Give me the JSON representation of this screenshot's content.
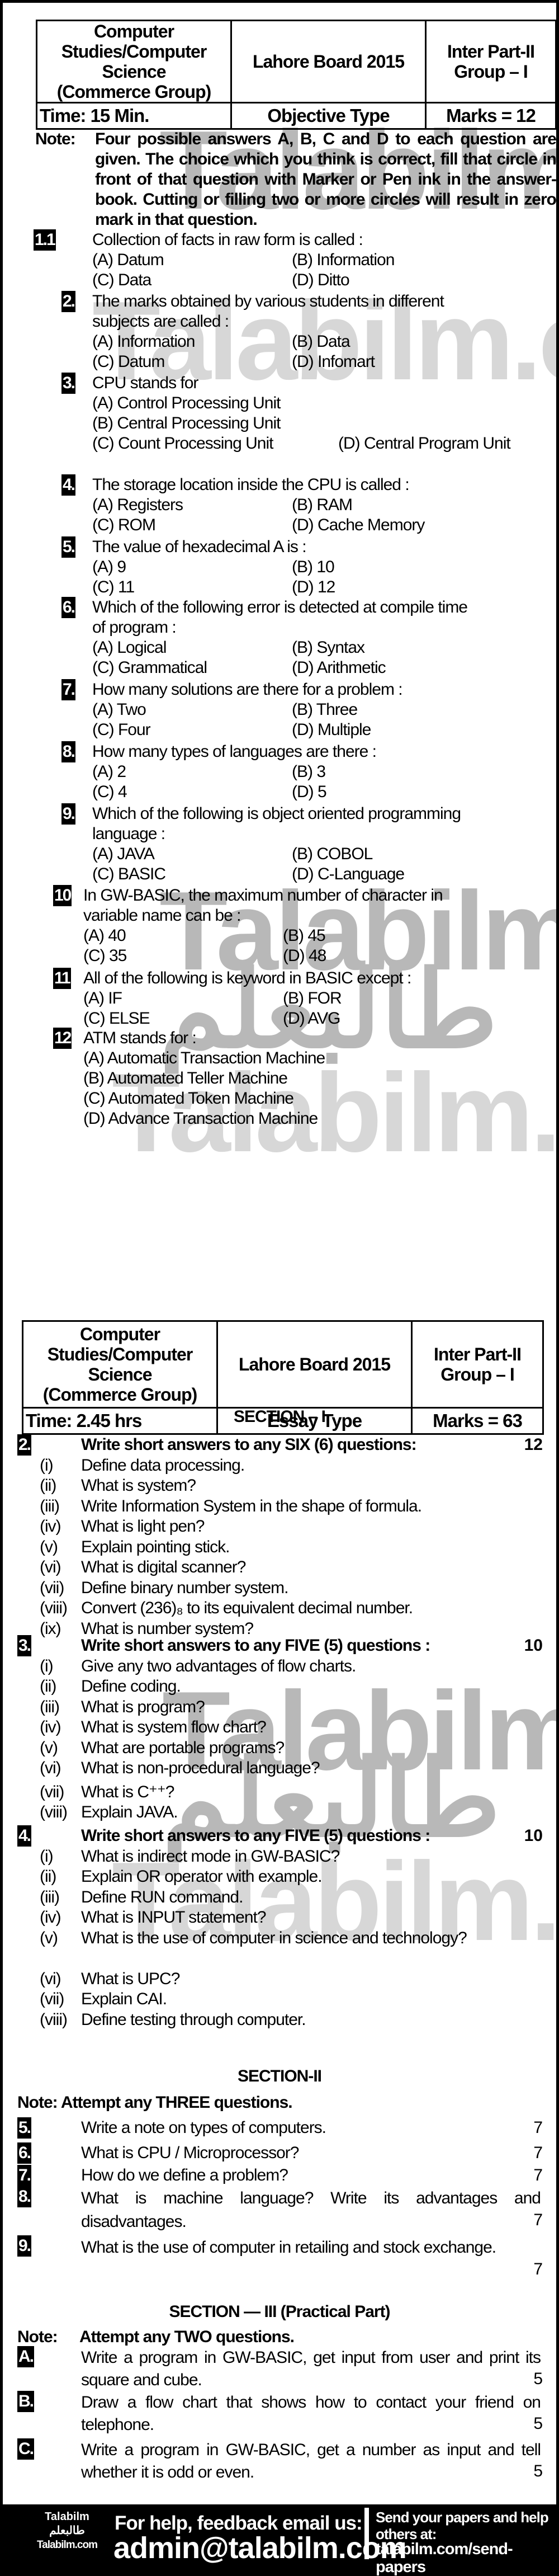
{
  "objective_header": {
    "subject_lines": [
      "Computer",
      "Studies/Computer",
      "Science",
      "(Commerce Group)"
    ],
    "board": "Lahore Board 2015",
    "class_lines": [
      "Inter Part-II",
      "Group – I"
    ],
    "time": "Time: 15 Min.",
    "paper_type": "Objective Type",
    "marks": "Marks = 12"
  },
  "objective_note": {
    "label": "Note:",
    "text": "Four possible answers A, B, C and D to each question are given. The choice which you think is correct, fill that circle in front of that question with Marker or Pen ink in the answer-book. Cutting or filling two or more circles will result in zero mark in that question."
  },
  "mcqs": [
    {
      "num": "1.1",
      "lines": [
        "Collection of facts in raw form is called :"
      ],
      "options": [
        "(A) Datum",
        "(B) Information",
        "(C) Data",
        "(D) Ditto"
      ]
    },
    {
      "num": "2.",
      "lines": [
        "The marks obtained by various students in different",
        "subjects are called :"
      ],
      "options": [
        "(A) Information",
        "(B) Data",
        "(C) Datum",
        "(D) Infomart"
      ]
    },
    {
      "num": "3.",
      "lines": [
        "CPU stands for"
      ],
      "options": [
        "(A) Control Processing Unit",
        "(B) Central Processing Unit",
        "(C) Count Processing Unit",
        "(D) Central Program Unit"
      ]
    },
    {
      "num": "4.",
      "lines": [
        "The storage location inside the CPU is called :"
      ],
      "options": [
        "(A) Registers",
        "(B) RAM",
        "(C) ROM",
        "(D) Cache Memory"
      ]
    },
    {
      "num": "5.",
      "lines": [
        "The value of hexadecimal A is :"
      ],
      "options": [
        "(A) 9",
        "(B) 10",
        "(C) 11",
        "(D) 12"
      ]
    },
    {
      "num": "6.",
      "lines": [
        "Which of the following error is detected at compile time",
        "of program :"
      ],
      "options": [
        "(A) Logical",
        "(B) Syntax",
        "(C) Grammatical",
        "(D) Arithmetic"
      ]
    },
    {
      "num": "7.",
      "lines": [
        "How many solutions are there for a problem :"
      ],
      "options": [
        "(A) Two",
        "(B) Three",
        "(C) Four",
        "(D) Multiple"
      ]
    },
    {
      "num": "8.",
      "lines": [
        "How many types of languages are there :"
      ],
      "options": [
        "(A) 2",
        "(B) 3",
        "(C) 4",
        "(D) 5"
      ]
    },
    {
      "num": "9.",
      "lines": [
        "Which of the following is object oriented programming",
        "language :"
      ],
      "options": [
        "(A) JAVA",
        "(B) COBOL",
        "(C) BASIC",
        "(D) C-Language"
      ]
    },
    {
      "num": "10",
      "lines": [
        "In GW-BASIC, the maximum number of character in",
        "variable name can be :"
      ],
      "options": [
        "(A) 40",
        "(B) 45",
        "(C) 35",
        "(D) 48"
      ]
    },
    {
      "num": "11",
      "lines": [
        "All of the following is keyword in BASIC except :"
      ],
      "options": [
        "(A) IF",
        "(B) FOR",
        "(C) ELSE",
        "(D) AVG"
      ]
    },
    {
      "num": "12",
      "lines": [
        "ATM stands for :"
      ],
      "options": [
        "(A) Automatic Transaction Machine",
        "(B) Automated Teller Machine",
        "(C) Automated Token Machine",
        "(D) Advance Transaction Machine"
      ]
    }
  ],
  "essay_header": {
    "subject_lines": [
      "Computer",
      "Studies/Computer",
      "Science",
      "(Commerce Group)"
    ],
    "board": "Lahore Board 2015",
    "class_lines": [
      "Inter Part-II",
      "Group – I"
    ],
    "time": "Time: 2.45 hrs",
    "paper_type": "Essay Type",
    "marks": "Marks = 63"
  },
  "section1": {
    "title": "SECTION – I",
    "questions": [
      {
        "num": "2.",
        "instruction": "Write short answers to any SIX (6) questions:",
        "marks": "12",
        "parts": [
          {
            "roman": "(i)",
            "text": "Define data processing."
          },
          {
            "roman": "(ii)",
            "text": "What is system?"
          },
          {
            "roman": "(iii)",
            "text": "Write Information System in the shape of formula."
          },
          {
            "roman": "(iv)",
            "text": "What is light pen?"
          },
          {
            "roman": "(v)",
            "text": "Explain pointing stick."
          },
          {
            "roman": "(vi)",
            "text": "What is digital scanner?"
          },
          {
            "roman": "(vii)",
            "text": "Define binary number system."
          },
          {
            "roman": "(viii)",
            "text": "Convert (236)₈ to its equivalent decimal number."
          },
          {
            "roman": "(ix)",
            "text": "What is number system?"
          }
        ]
      },
      {
        "num": "3.",
        "instruction": "Write short answers to any FIVE (5) questions :",
        "marks": "10",
        "parts": [
          {
            "roman": "(i)",
            "text": "Give any two advantages of flow charts."
          },
          {
            "roman": "(ii)",
            "text": "Define coding."
          },
          {
            "roman": "(iii)",
            "text": "What is program?"
          },
          {
            "roman": "(iv)",
            "text": "What is system flow chart?"
          },
          {
            "roman": "(v)",
            "text": "What are portable programs?"
          },
          {
            "roman": "(vi)",
            "text": "What is non-procedural language?"
          },
          {
            "roman": "(vii)",
            "text": "What is C⁺⁺?"
          },
          {
            "roman": "(viii)",
            "text": "Explain JAVA."
          }
        ]
      },
      {
        "num": "4.",
        "instruction": "Write short answers to any FIVE (5) questions :",
        "marks": "10",
        "parts": [
          {
            "roman": "(i)",
            "text": "What is indirect mode in GW-BASIC?"
          },
          {
            "roman": "(ii)",
            "text": "Explain OR operator with example."
          },
          {
            "roman": "(iii)",
            "text": "Define RUN command."
          },
          {
            "roman": "(iv)",
            "text": "What is INPUT statement?"
          },
          {
            "roman": "(v)",
            "text": "What is the use of computer in science and technology?"
          },
          {
            "roman": "(vi)",
            "text": "What is UPC?"
          },
          {
            "roman": "(vii)",
            "text": "Explain CAI."
          },
          {
            "roman": "(viii)",
            "text": "Define testing through computer."
          }
        ]
      }
    ]
  },
  "section2": {
    "title": "SECTION-II",
    "note": "Note: Attempt any THREE questions.",
    "questions": [
      {
        "num": "5.",
        "text": "Write a note on types of computers.",
        "marks": "7"
      },
      {
        "num": "6.",
        "text": "What is CPU / Microprocessor?",
        "marks": "7"
      },
      {
        "num": "7.",
        "text": "How do we define a problem?",
        "marks": "7"
      },
      {
        "num": "8.",
        "text": "What is machine language? Write its advantages and disadvantages.",
        "marks": "7"
      },
      {
        "num": "9.",
        "text": "What is the use of computer in retailing and stock exchange.",
        "marks": "7"
      }
    ]
  },
  "section3": {
    "title": "SECTION — III (Practical Part)",
    "note_label": "Note:",
    "note": "Attempt any TWO questions.",
    "questions": [
      {
        "num": "A.",
        "text": "Write a program in GW-BASIC, get input from user and print its square and cube.",
        "marks": "5"
      },
      {
        "num": "B.",
        "text": "Draw a flow chart that shows how to contact your friend on telephone.",
        "marks": "5"
      },
      {
        "num": "C.",
        "text": "Write a program in GW-BASIC, get a number as input and tell whether it is odd or even.",
        "marks": "5"
      }
    ]
  },
  "watermark": {
    "latin": "Talabilm",
    "latin_com": "Talabilm.com",
    "urdu": "طالبعلم"
  },
  "footer": {
    "brand_top": "Talabilm",
    "brand_urdu": "طالبعلم",
    "brand_bottom": "Talabilm.com",
    "help_label": "For help, feedback email us:",
    "email": "admin@talabilm.com",
    "send_label": "Send your papers and help others at:",
    "send_url": "talabilm.com/send-papers"
  }
}
